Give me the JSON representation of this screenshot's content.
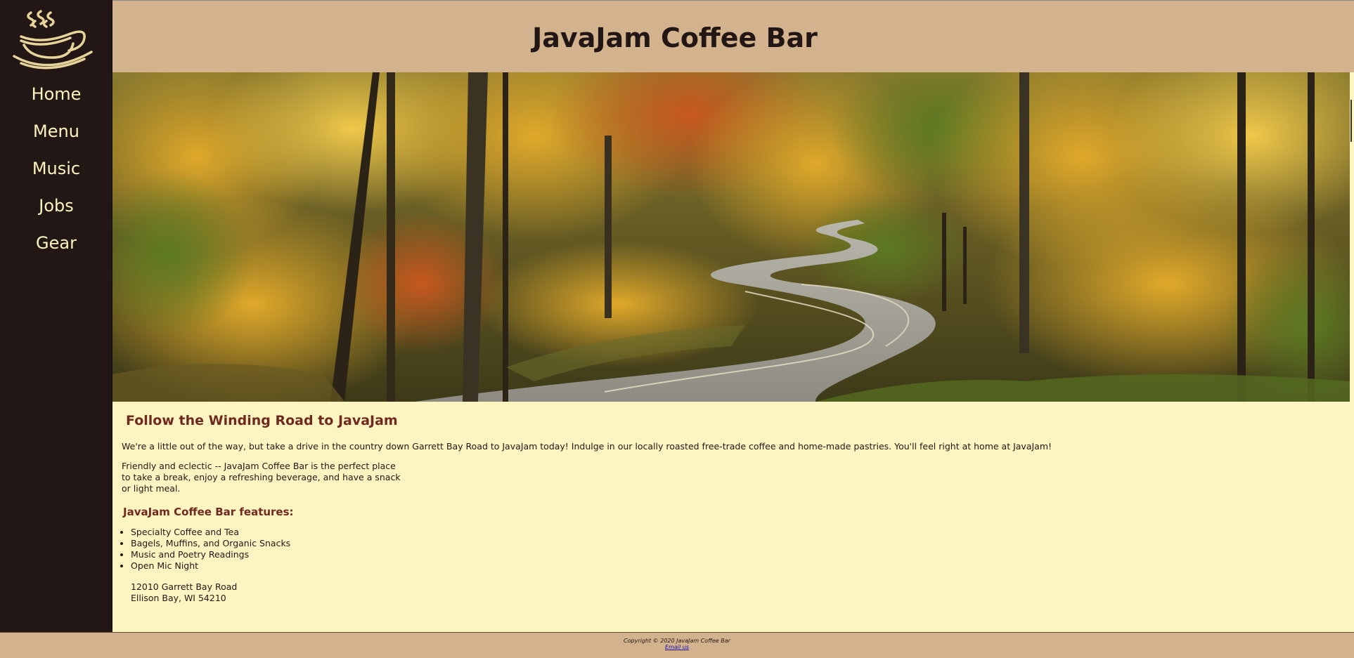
{
  "site": {
    "title": "JavaJam Coffee Bar"
  },
  "nav": {
    "items": [
      {
        "label": "Home"
      },
      {
        "label": "Menu"
      },
      {
        "label": "Music"
      },
      {
        "label": "Jobs"
      },
      {
        "label": "Gear"
      }
    ]
  },
  "hero": {
    "alt": "Winding road through autumn forest"
  },
  "main": {
    "heading": "Follow the Winding Road to JavaJam",
    "intro": "We're a little out of the way, but take a drive in the country down Garrett Bay Road to JavaJam today! Indulge in our locally roasted free-trade coffee and home-made pastries. You'll feel right at home at JavaJam!",
    "friendly": "Friendly and eclectic -- JavaJam Coffee Bar is the perfect place to take a break, enjoy a refreshing beverage, and have a snack or light meal.",
    "features_heading": "JavaJam Coffee Bar features:",
    "features": [
      "Specialty Coffee and Tea",
      "Bagels, Muffins, and Organic Snacks",
      "Music and Poetry Readings",
      "Open Mic Night"
    ],
    "address": {
      "street": "12010 Garrett Bay Road",
      "city": "Ellison Bay, WI 54210"
    }
  },
  "footer": {
    "copyright": "Copyright © 2020 JavaJam Coffee Bar",
    "email_label": "Email us"
  },
  "colors": {
    "nav_bg": "#221714",
    "header_bg": "#d3b38d",
    "content_bg": "#fdf5c1",
    "heading": "#6f2a1f",
    "nav_text": "#fdf5c1"
  },
  "icons": {
    "logo": "steaming-coffee-cup-icon"
  }
}
